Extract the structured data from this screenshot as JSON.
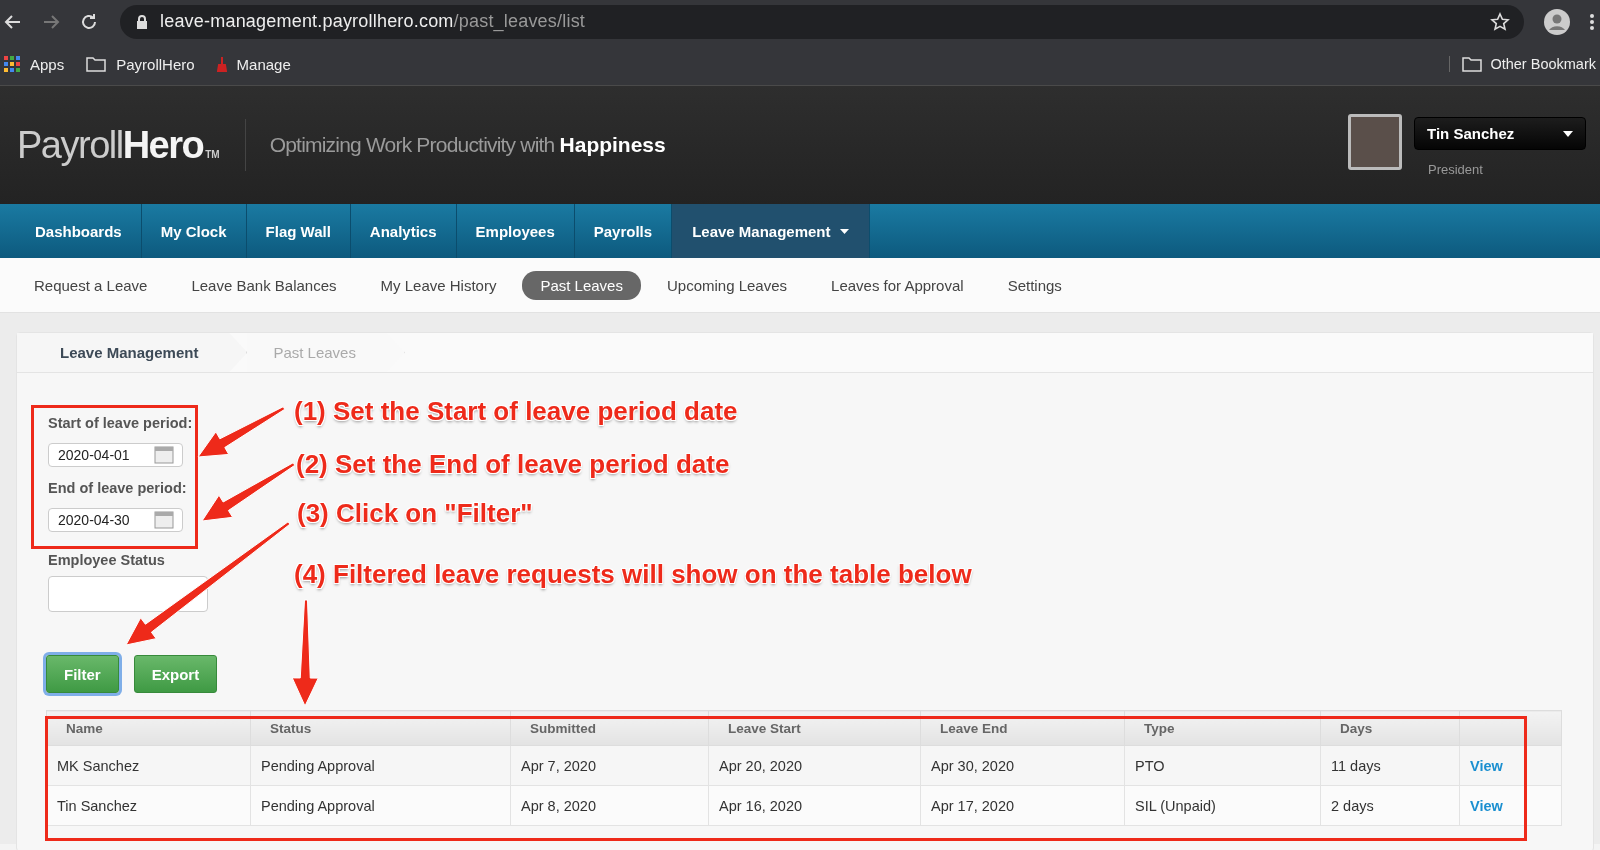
{
  "browser": {
    "url_host": "leave-management.payrollhero.com",
    "url_path": "/past_leaves/list"
  },
  "bookmarks": [
    {
      "label": "Apps",
      "kind": "apps"
    },
    {
      "label": "PayrollHero",
      "kind": "folder"
    },
    {
      "label": "Manage",
      "kind": "page"
    }
  ],
  "other_bookmarks": "Other Bookmark",
  "header": {
    "logo_light": "Payroll",
    "logo_bold": "Hero",
    "logo_mark": "TM",
    "tagline": "Optimizing Work Productivity with **Happiness**",
    "user_name": "Tin Sanchez",
    "user_role": "President"
  },
  "nav": [
    {
      "label": "Dashboards",
      "selected": false,
      "dropdown": false
    },
    {
      "label": "My Clock",
      "selected": false,
      "dropdown": false
    },
    {
      "label": "Flag Wall",
      "selected": false,
      "dropdown": false
    },
    {
      "label": "Analytics",
      "selected": false,
      "dropdown": false
    },
    {
      "label": "Employees",
      "selected": false,
      "dropdown": false
    },
    {
      "label": "Payrolls",
      "selected": false,
      "dropdown": false
    },
    {
      "label": "Leave Management",
      "selected": true,
      "dropdown": true
    }
  ],
  "subnav": [
    {
      "label": "Request a Leave",
      "selected": false
    },
    {
      "label": "Leave Bank Balances",
      "selected": false
    },
    {
      "label": "My Leave History",
      "selected": false
    },
    {
      "label": "Past Leaves",
      "selected": true
    },
    {
      "label": "Upcoming Leaves",
      "selected": false
    },
    {
      "label": "Leaves for Approval",
      "selected": false
    },
    {
      "label": "Settings",
      "selected": false
    }
  ],
  "breadcrumb": [
    "Leave Management",
    "Past Leaves"
  ],
  "filters": [
    {
      "kind": "date",
      "label": "Start of leave period:",
      "value": "2020-04-01"
    },
    {
      "kind": "date",
      "label": "End of leave period:",
      "value": "2020-04-30"
    },
    {
      "kind": "select",
      "label": "Employee Status"
    }
  ],
  "buttons": [
    {
      "label": "Filter",
      "focused": true
    },
    {
      "label": "Export",
      "focused": false
    }
  ],
  "table": {
    "columns": [
      "Name",
      "Status",
      "Submitted",
      "Leave Start",
      "Leave End",
      "Type",
      "Days"
    ],
    "rows": [
      {
        "cells": [
          "MK Sanchez",
          "Pending Approval",
          "Apr 7, 2020",
          "Apr 20, 2020",
          "Apr 30, 2020",
          "PTO",
          "11 days"
        ],
        "action": "View"
      },
      {
        "cells": [
          "Tin Sanchez",
          "Pending Approval",
          "Apr 8, 2020",
          "Apr 16, 2020",
          "Apr 17, 2020",
          "SIL (Unpaid)",
          "2 days"
        ],
        "action": "View"
      }
    ]
  },
  "annotations": [
    "(1) Set the Start of leave period date",
    "(2) Set the End of leave period date",
    "(3) Click on \"Filter\"",
    "(4) Filtered leave requests will show on the table below"
  ]
}
